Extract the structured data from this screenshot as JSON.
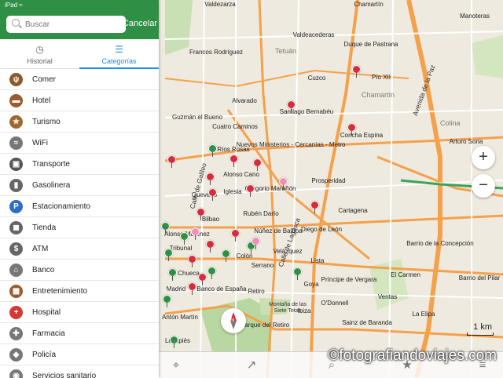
{
  "status": {
    "device": "iPad"
  },
  "search": {
    "placeholder": "Buscar",
    "cancel_label": "Cancelar"
  },
  "tabs": [
    {
      "label": "Historial",
      "icon": "history-icon",
      "active": false
    },
    {
      "label": "Categorías",
      "icon": "categories-icon",
      "active": true
    }
  ],
  "categories": [
    {
      "label": "Comer",
      "icon": "food-icon",
      "color": "#8a5a2b"
    },
    {
      "label": "Hotel",
      "icon": "bed-icon",
      "color": "#9a5b2e"
    },
    {
      "label": "Turismo",
      "icon": "star-icon",
      "color": "#a0662e"
    },
    {
      "label": "WiFi",
      "icon": "wifi-icon",
      "color": "#777777"
    },
    {
      "label": "Transporte",
      "icon": "bus-icon",
      "color": "#555555"
    },
    {
      "label": "Gasolinera",
      "icon": "fuel-icon",
      "color": "#666666"
    },
    {
      "label": "Estacionamiento",
      "icon": "parking-icon",
      "color": "#2e6fc4"
    },
    {
      "label": "Tienda",
      "icon": "shop-icon",
      "color": "#666666"
    },
    {
      "label": "ATM",
      "icon": "atm-icon",
      "color": "#666666"
    },
    {
      "label": "Banco",
      "icon": "bank-icon",
      "color": "#777777"
    },
    {
      "label": "Entretenimiento",
      "icon": "entertainment-icon",
      "color": "#9a5b2e"
    },
    {
      "label": "Hospital",
      "icon": "hospital-icon",
      "color": "#d33a33"
    },
    {
      "label": "Farmacia",
      "icon": "pharmacy-icon",
      "color": "#777777"
    },
    {
      "label": "Policía",
      "icon": "police-icon",
      "color": "#777777"
    },
    {
      "label": "Servicios sanitario",
      "icon": "toilet-icon",
      "color": "#777777"
    }
  ],
  "map": {
    "districts": [
      "Tetuán",
      "Chamartín",
      "Colina"
    ],
    "streets": [
      "Valdezarza",
      "Chamartín",
      "Valdeacederas",
      "Duque de Pastrana",
      "Francos Rodríguez",
      "Pío XII",
      "Cuzco",
      "Alvarado",
      "Guzmán el Bueno",
      "Cuatro Caminos",
      "Santiago Bernabéu",
      "Concha Espina",
      "Nuevos Ministerios - Cercanías - Metro",
      "Ríos Rosas",
      "Alonso Cano",
      "Gregorio Marañón",
      "Iglesia",
      "Quevedo",
      "Bilbao",
      "Colón",
      "Serrano",
      "Velázquez",
      "Goya",
      "Retiro",
      "O'Donnell",
      "Ibiza",
      "Sainz de Baranda",
      "Parque del Retiro",
      "Príncipe de Vergara",
      "Prosperidad",
      "Cartagena",
      "Diego de León",
      "Lista",
      "Núñez de Balboa",
      "Rubén Darío",
      "Alonso Martínez",
      "Tribunal",
      "Chueca",
      "Madrid",
      "Banco de España",
      "Antón Martín",
      "Lavapiés",
      "Barrio de la Concepción",
      "El Carmen",
      "Ventas",
      "La Elipa",
      "Arturo Soria",
      "Manoteras",
      "Barrio del Pilar",
      "Avenida de la Paz",
      "Calle de Galileo",
      "Calle de Lagasca",
      "Montaña de las Siete Tetas"
    ],
    "scale_label": "1 km",
    "watermark": "©fotografiandoviajes.com"
  }
}
